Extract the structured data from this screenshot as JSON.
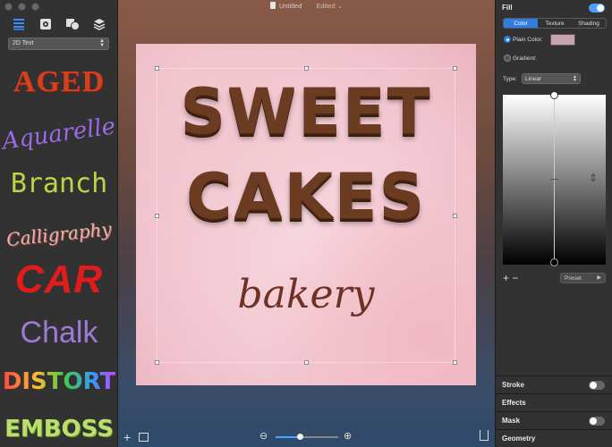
{
  "window": {
    "title": "Untitled",
    "status": "Edited ⌄"
  },
  "colors": {
    "accent": "#2f7de1",
    "toggle_on": "#4aa3ff",
    "plain_color": "#c8a4b2",
    "chocolate": "#6b3b22"
  },
  "sidebar": {
    "tabs": [
      {
        "name": "text-styles-tab",
        "icon": "list-icon",
        "active": true
      },
      {
        "name": "settings-tab",
        "icon": "gear-icon"
      },
      {
        "name": "shapes-tab",
        "icon": "shapes-icon"
      },
      {
        "name": "layers-tab",
        "icon": "layers-icon"
      }
    ],
    "mode_select": "2D Text",
    "styles": [
      "AGED",
      "Aquarelle",
      "Branch",
      "Calligraphy",
      "CAR",
      "Chalk",
      "DISTORT",
      "EMBOSS"
    ]
  },
  "canvas": {
    "line1": "SWEET",
    "line2": "CAKES",
    "line3": "bakery",
    "zoom_level": 0.38
  },
  "inspector": {
    "fill": {
      "label": "Fill",
      "enabled": true
    },
    "fill_tabs": [
      "Color",
      "Texture",
      "Shading"
    ],
    "plain_color_label": "Plain Color:",
    "gradient_label": "Gradient:",
    "type_label": "Type:",
    "type_value": "Linear",
    "preset_label": "Preset",
    "add_stop": "+",
    "remove_stop": "−",
    "sections": [
      {
        "label": "Stroke",
        "toggle": true,
        "on": false
      },
      {
        "label": "Effects",
        "toggle": false
      },
      {
        "label": "Mask",
        "toggle": true,
        "on": false
      },
      {
        "label": "Geometry",
        "toggle": false
      }
    ]
  }
}
